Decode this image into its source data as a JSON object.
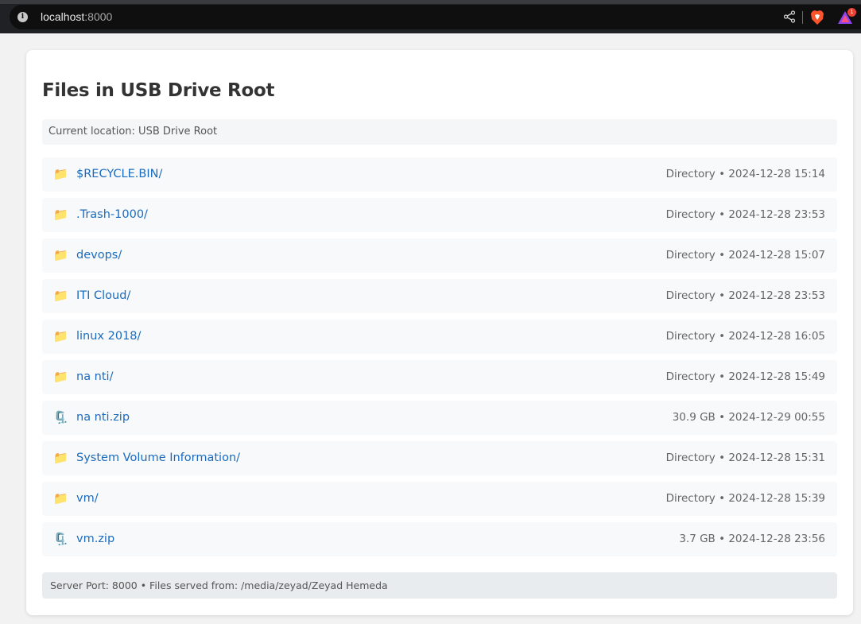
{
  "browser": {
    "url_host": "localhost",
    "url_port": ":8000",
    "rewards_badge": "1"
  },
  "page": {
    "title": "Files in USB Drive Root",
    "location": "Current location: USB Drive Root",
    "footer": "Server Port: 8000 • Files served from: /media/zeyad/Zeyad Hemeda"
  },
  "files": [
    {
      "icon": "folder-icon",
      "name": "$RECYCLE.BIN/",
      "meta": "Directory • 2024-12-28 15:14"
    },
    {
      "icon": "folder-icon",
      "name": ".Trash-1000/",
      "meta": "Directory • 2024-12-28 23:53"
    },
    {
      "icon": "folder-icon",
      "name": "devops/",
      "meta": "Directory • 2024-12-28 15:07"
    },
    {
      "icon": "folder-icon",
      "name": "ITI Cloud/",
      "meta": "Directory • 2024-12-28 23:53"
    },
    {
      "icon": "folder-icon",
      "name": "linux 2018/",
      "meta": "Directory • 2024-12-28 16:05"
    },
    {
      "icon": "folder-icon",
      "name": "na nti/",
      "meta": "Directory • 2024-12-28 15:49"
    },
    {
      "icon": "zip-file-icon",
      "name": "na nti.zip",
      "meta": "30.9 GB • 2024-12-29 00:55"
    },
    {
      "icon": "folder-icon",
      "name": "System Volume Information/",
      "meta": "Directory • 2024-12-28 15:31"
    },
    {
      "icon": "folder-icon",
      "name": "vm/",
      "meta": "Directory • 2024-12-28 15:39"
    },
    {
      "icon": "zip-file-icon",
      "name": "vm.zip",
      "meta": "3.7 GB • 2024-12-28 23:56"
    }
  ],
  "colors": {
    "link": "#1a6bbf",
    "row_bg": "#f8f9fa",
    "footer_bg": "#e9ecef",
    "browser_bg": "#202124"
  }
}
